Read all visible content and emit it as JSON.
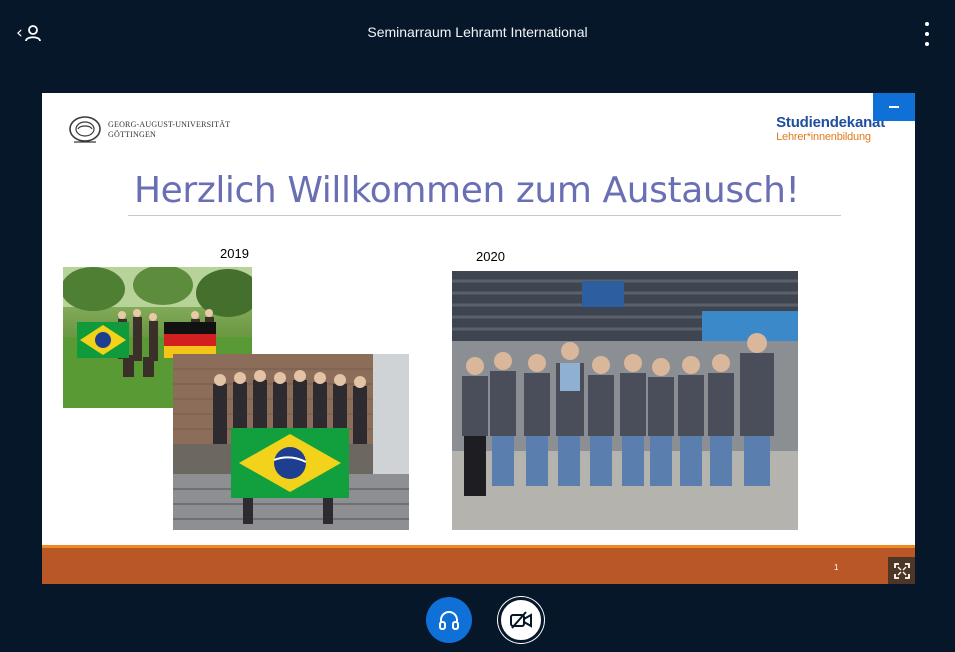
{
  "header": {
    "title": "Seminarraum Lehramt International",
    "users_icon": "user-icon",
    "options_icon": "more-vertical-icon"
  },
  "presentation": {
    "minimize_icon": "minimize-icon",
    "fullscreen_icon": "fullscreen-icon",
    "slide": {
      "university_logo_line1": "GEORG-AUGUST-UNIVERSITÄT",
      "university_logo_line2": "GÖTTINGEN",
      "dept_logo_line1": "Studiendekanat",
      "dept_logo_line2": "Lehrer*innenbildung",
      "heading": "Herzlich Willkommen zum Austausch!",
      "year_left": "2019",
      "year_right": "2020",
      "page_number": "1"
    }
  },
  "controls": {
    "audio_icon": "headphones-icon",
    "video_icon": "camera-off-icon"
  },
  "colors": {
    "background": "#06172a",
    "accent_blue": "#0f70d7",
    "heading_purple": "#6a6fb4",
    "slide_band": "#b95826",
    "slide_stripe": "#f08a24"
  }
}
